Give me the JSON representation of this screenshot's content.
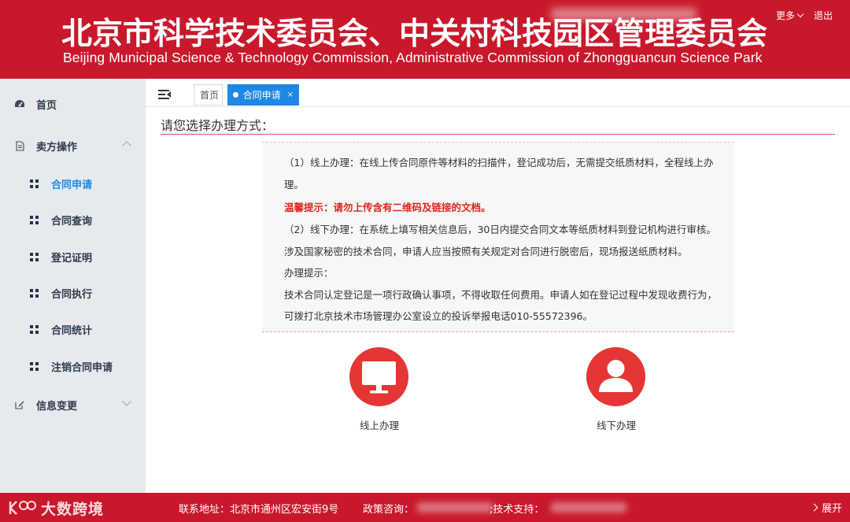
{
  "header": {
    "title_cn": "北京市科学技术委员会、中关村科技园区管理委员会",
    "title_en": "Beijing Municipal Science & Technology Commission, Administrative Commission of Zhongguancun Science Park",
    "link_more": "更多",
    "link_logout": "退出"
  },
  "sidebar": {
    "home": "首页",
    "seller_ops": "卖方操作",
    "sub_items": [
      "合同申请",
      "合同查询",
      "登记证明",
      "合同执行",
      "合同统计",
      "注销合同申请"
    ],
    "info_change": "信息变更"
  },
  "tabs": {
    "home": "首页",
    "active": "合同申请",
    "close": "×"
  },
  "main": {
    "title": "请您选择办理方式：",
    "notice_lines": [
      "（1）线上办理：在线上传合同原件等材料的扫描件，登记成功后，无需提交纸质材料，全程线上办",
      "理。",
      "温馨提示：请勿上传含有二维码及链接的文档。",
      "（2）线下办理：在系统上填写相关信息后，30日内提交合同文本等纸质材料到登记机构进行审核。",
      "涉及国家秘密的技术合同，申请人应当按照有关规定对合同进行脱密后，现场报送纸质材料。",
      "办理提示：",
      "技术合同认定登记是一项行政确认事项，不得收取任何费用。申请人如在登记过程中发现收费行为，",
      "可拨打北京技术市场管理办公室设立的投诉举报电话010-55572396。"
    ],
    "online_label": "线上办理",
    "offline_label": "线下办理"
  },
  "footer": {
    "brand": "大数跨境",
    "address": "联系地址：北京市通州区宏安街9号",
    "policy": "政策咨询：",
    "support": ";技术支持：",
    "expand": "展开"
  },
  "colors": {
    "brand_red": "#c9182c",
    "accent_blue": "#1e88e5",
    "button_red": "#e63535",
    "warning_red": "#e1251b"
  }
}
